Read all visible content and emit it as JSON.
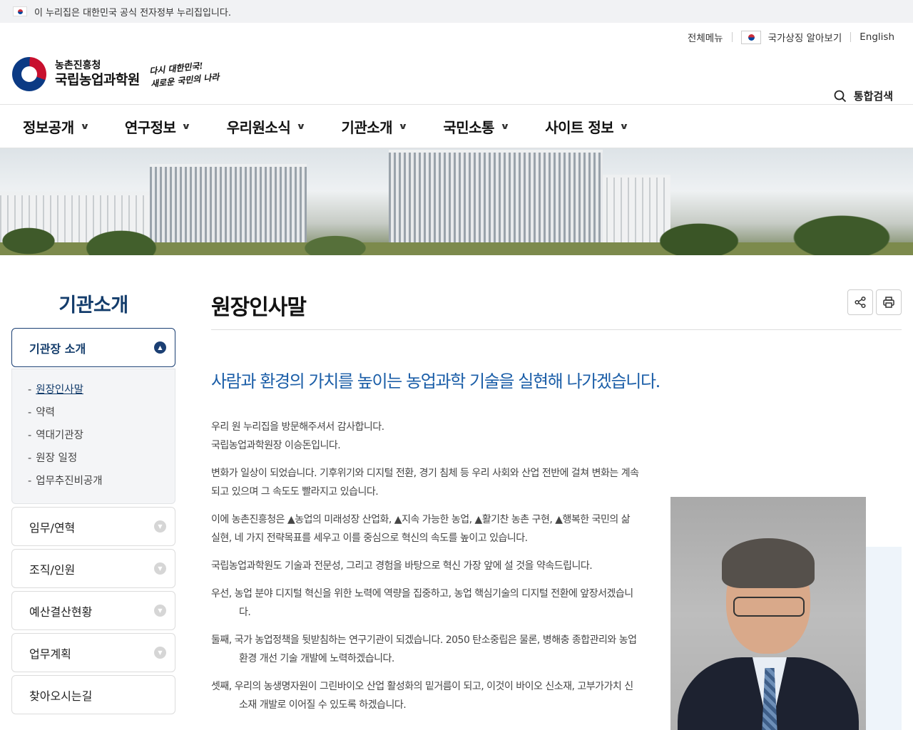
{
  "gov_banner": {
    "text": "이 누리집은 대한민국 공식 전자정부 누리집입니다."
  },
  "utility": {
    "all_menu": "전체메뉴",
    "national_symbol": "국가상징 알아보기",
    "english": "English"
  },
  "logo": {
    "sub": "농촌진흥청",
    "main": "국립농업과학원",
    "slogan_line1": "다시 대한민국!",
    "slogan_line2": "새로운 국민의 나라"
  },
  "search": {
    "label": "통합검색"
  },
  "nav": [
    {
      "label": "정보공개"
    },
    {
      "label": "연구정보"
    },
    {
      "label": "우리원소식"
    },
    {
      "label": "기관소개"
    },
    {
      "label": "국민소통"
    },
    {
      "label": "사이트 정보"
    }
  ],
  "sidebar": {
    "title": "기관소개",
    "active_group": "기관장 소개",
    "submenu": [
      "원장인사말",
      "약력",
      "역대기관장",
      "원장 일정",
      "업무추진비공개"
    ],
    "items": [
      "임무/연혁",
      "조직/인원",
      "예산결산현황",
      "업무계획",
      "찾아오시는길"
    ]
  },
  "main": {
    "title": "원장인사말",
    "headline": "사람과 환경의 가치를 높이는 농업과학 기술을 실현해 나가겠습니다.",
    "paragraphs": [
      {
        "text": "우리 원 누리집을 방문해주셔서 감사합니다.",
        "cls": "tight"
      },
      {
        "text": "국립농업과학원장 이승돈입니다.",
        "cls": ""
      },
      {
        "text": "변화가 일상이 되었습니다.  기후위기와 디지털 전환,  경기 침체 등 우리 사회와 산업 전반에 걸쳐 변화는 계속되고 있으며 그 속도도 빨라지고 있습니다.",
        "cls": ""
      },
      {
        "text": "이에 농촌진흥청은 ▲농업의 미래성장 산업화,  ▲지속 가능한 농업,  ▲활기찬 농촌 구현,  ▲행복한 국민의 삶 실현,  네 가지 전략목표를 세우고 이를 중심으로 혁신의 속도를 높이고 있습니다.",
        "cls": ""
      },
      {
        "text": "국립농업과학원도 기술과 전문성,  그리고 경험을 바탕으로 혁신 가장 앞에 설 것을 약속드립니다.",
        "cls": ""
      },
      {
        "text": "우선,   농업 분야 디지털 혁신을 위한 노력에 역량을 집중하고,  농업 핵심기술의 디지털 전환에 앞장서겠습니다.",
        "cls": "list"
      },
      {
        "text": "둘째,   국가 농업정책을 뒷받침하는 연구기관이 되겠습니다.  2050 탄소중립은 물론,  병해충 종합관리와 농업환경 개선 기술 개발에 노력하겠습니다.",
        "cls": "list"
      },
      {
        "text": "셋째,   우리의 농생명자원이 그린바이오 산업 활성화의 밑거름이 되고,  이것이 바이오 신소재,  고부가가치 신소재 개발로 이어질 수 있도록 하겠습니다.",
        "cls": "list"
      }
    ]
  }
}
